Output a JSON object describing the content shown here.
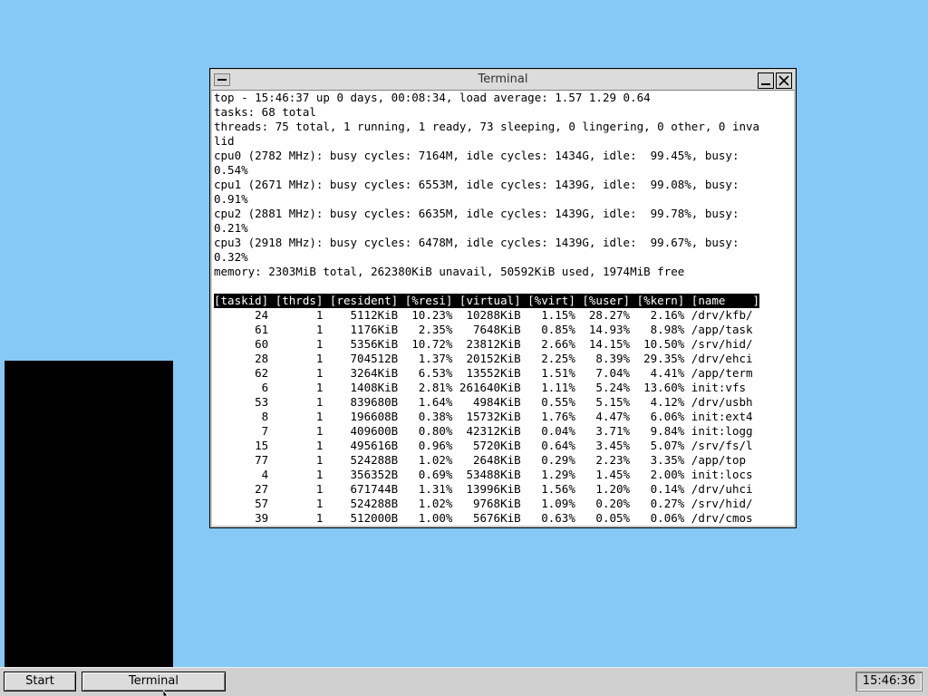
{
  "window": {
    "title": "Terminal"
  },
  "terminal": {
    "summary_lines": [
      "top - 15:46:37 up 0 days, 00:08:34, load average: 1.57 1.29 0.64",
      "tasks: 68 total",
      "threads: 75 total, 1 running, 1 ready, 73 sleeping, 0 lingering, 0 other, 0 inva",
      "lid",
      "cpu0 (2782 MHz): busy cycles: 7164M, idle cycles: 1434G, idle:  99.45%, busy:",
      "0.54%",
      "cpu1 (2671 MHz): busy cycles: 6553M, idle cycles: 1439G, idle:  99.08%, busy:",
      "0.91%",
      "cpu2 (2881 MHz): busy cycles: 6635M, idle cycles: 1439G, idle:  99.78%, busy:",
      "0.21%",
      "cpu3 (2918 MHz): busy cycles: 6478M, idle cycles: 1439G, idle:  99.67%, busy:",
      "0.32%",
      "memory: 2303MiB total, 262380KiB unavail, 50592KiB used, 1974MiB free",
      ""
    ],
    "table_header": "[taskid] [thrds] [resident] [%resi] [virtual] [%virt] [%user] [%kern] [name    ]",
    "rows": [
      "      24       1    5112KiB  10.23%  10288KiB   1.15%  28.27%   2.16% /drv/kfb/",
      "      61       1    1176KiB   2.35%   7648KiB   0.85%  14.93%   8.98% /app/task",
      "      60       1    5356KiB  10.72%  23812KiB   2.66%  14.15%  10.50% /srv/hid/",
      "      28       1    704512B   1.37%  20152KiB   2.25%   8.39%  29.35% /drv/ehci",
      "      62       1    3264KiB   6.53%  13552KiB   1.51%   7.04%   4.41% /app/term",
      "       6       1    1408KiB   2.81% 261640KiB   1.11%   5.24%  13.60% init:vfs",
      "      53       1    839680B   1.64%   4984KiB   0.55%   5.15%   4.12% /drv/usbh",
      "       8       1    196608B   0.38%  15732KiB   1.76%   4.47%   6.06% init:ext4",
      "       7       1    409600B   0.80%  42312KiB   0.04%   3.71%   9.84% init:logg",
      "      15       1    495616B   0.96%   5720KiB   0.64%   3.45%   5.07% /srv/fs/l",
      "      77       1    524288B   1.02%   2648KiB   0.29%   2.23%   3.35% /app/top",
      "       4       1    356352B   0.69%  53488KiB   1.29%   1.45%   2.00% init:locs",
      "      27       1    671744B   1.31%  13996KiB   1.56%   1.20%   0.14% /drv/uhci",
      "      57       1    524288B   1.02%   9768KiB   1.09%   0.20%   0.27% /srv/hid/",
      "      39       1    512000B   1.00%   5676KiB   0.63%   0.05%   0.06% /drv/cmos"
    ]
  },
  "taskbar": {
    "start_label": "Start",
    "task_label": "Terminal",
    "clock": "15:46:36"
  },
  "colors": {
    "desktop": "#86c8f6",
    "panel": "#000000",
    "window_chrome": "#d4d4d4"
  },
  "icons": {
    "system_menu": "menu-bar-icon",
    "minimize": "minimize-icon",
    "close": "close-icon",
    "cursor": "mouse-pointer-icon"
  }
}
